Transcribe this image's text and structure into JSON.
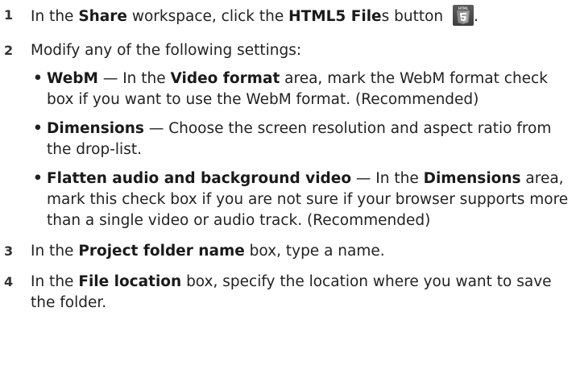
{
  "steps": [
    {
      "number": "1",
      "t1": "In the ",
      "b1": "Share",
      "t2": " workspace, click the ",
      "b2": "HTML5 File",
      "t3": "s button ",
      "t4": ".",
      "icon": "html5-icon"
    },
    {
      "number": "2",
      "text": "Modify any of the following settings:",
      "subitems": [
        {
          "bullet": "•",
          "b1": "WebM",
          "t1": " — In the ",
          "b2": "Video format",
          "t2": " area, mark the WebM format check box if you want to use the WebM format. (Recommended)"
        },
        {
          "bullet": "•",
          "b1": "Dimensions",
          "t1": " — Choose the screen resolution and aspect ratio from the drop-list."
        },
        {
          "bullet": "•",
          "b1": "Flatten audio and background video",
          "t1": " — In the ",
          "b2": "Dimensions",
          "t2": " area, mark this check box if you are not sure if your browser supports more than a single video or audio track. (Recommended)"
        }
      ]
    },
    {
      "number": "3",
      "t1": "In the ",
      "b1": "Project folder name",
      "t2": " box, type a name."
    },
    {
      "number": "4",
      "t1": "In the ",
      "b1": "File location",
      "t2": " box, specify the location where you want to save the folder."
    }
  ],
  "icon_label": "HTML"
}
